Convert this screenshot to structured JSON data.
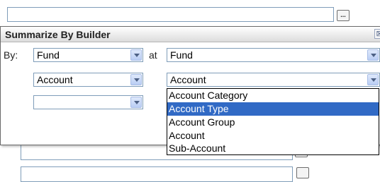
{
  "background_fields": {
    "ellipsis_label": "..."
  },
  "dialog": {
    "title": "Summarize By Builder",
    "close_glyph": "⊠",
    "by_label": "By:",
    "at_label": "at",
    "row1": {
      "left_value": "Fund",
      "right_value": "Fund"
    },
    "row2": {
      "left_value": "Account",
      "right_value": "Account"
    },
    "row3": {
      "left_value": ""
    }
  },
  "dropdown": {
    "options": [
      "Account Category",
      "Account Type",
      "Account Group",
      "Account",
      "Sub-Account"
    ],
    "selected": "Account Type",
    "highlight_color": "#316ac5"
  },
  "colors": {
    "border": "#7f9db9",
    "arrow_fill": "#b9cdf4"
  }
}
